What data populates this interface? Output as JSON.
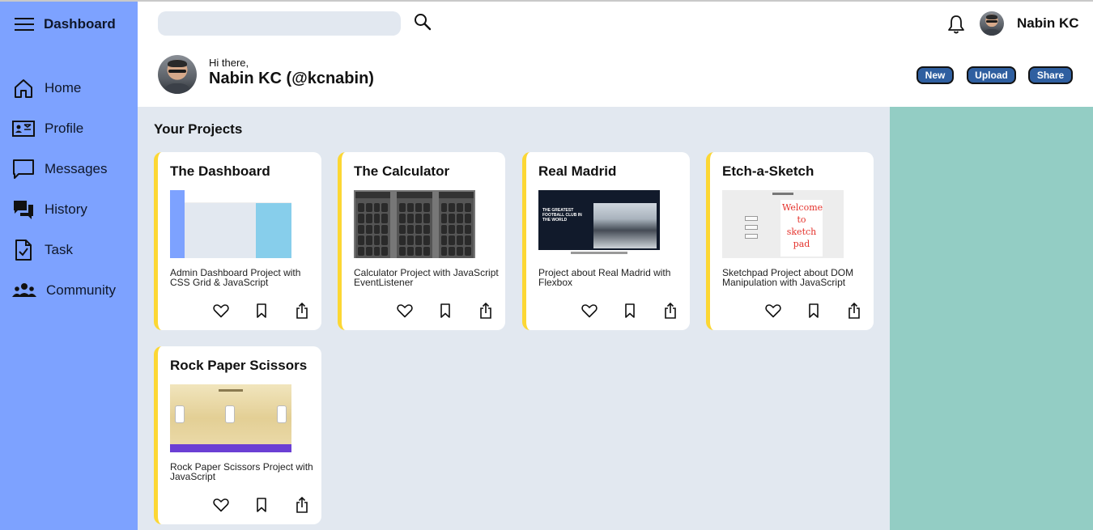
{
  "sidebar": {
    "title": "Dashboard",
    "items": [
      {
        "label": "Home",
        "icon": "home-icon"
      },
      {
        "label": "Profile",
        "icon": "profile-card-icon"
      },
      {
        "label": "Messages",
        "icon": "message-icon"
      },
      {
        "label": "History",
        "icon": "history-icon"
      },
      {
        "label": "Task",
        "icon": "task-icon"
      },
      {
        "label": "Community",
        "icon": "community-icon"
      }
    ]
  },
  "header": {
    "search_placeholder": "",
    "username": "Nabin KC",
    "greeting": "Hi there,",
    "handle": "Nabin KC (@kcnabin)",
    "buttons": {
      "new": "New",
      "upload": "Upload",
      "share": "Share"
    }
  },
  "projects": {
    "section_title": "Your Projects",
    "items": [
      {
        "title": "The Dashboard",
        "description": "Admin Dashboard Project with CSS Grid & JavaScript"
      },
      {
        "title": "The Calculator",
        "description": "Calculator Project with JavaScript EventListener"
      },
      {
        "title": "Real Madrid",
        "description": "Project about Real Madrid with Flexbox",
        "thumbnail_text": "THE GREATEST FOOTBALL CLUB IN THE WORLD"
      },
      {
        "title": "Etch-a-Sketch",
        "description": "Sketchpad Project about DOM Manipulation with JavaScript",
        "thumbnail_text": "Welcome to sketch pad"
      },
      {
        "title": "Rock Paper Scissors",
        "description": "Rock Paper Scissors Project with JavaScript"
      }
    ]
  },
  "colors": {
    "sidebar": "#7da2ff",
    "content_bg": "#e2e8f0",
    "right_panel": "#93cdc4",
    "card_accent": "#fcd734",
    "button_bg": "#2f5fa0"
  }
}
